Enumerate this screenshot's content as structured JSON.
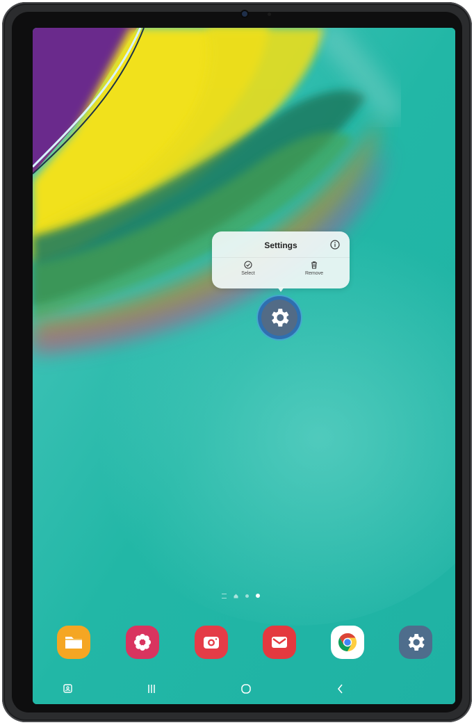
{
  "popup": {
    "title": "Settings",
    "info_icon": "info-icon",
    "actions": [
      {
        "label": "Select",
        "icon": "check-circle-icon"
      },
      {
        "label": "Remove",
        "icon": "trash-icon"
      }
    ]
  },
  "selected_app": {
    "name": "Settings",
    "icon": "gear-icon"
  },
  "page_indicator": {
    "pages": [
      "list",
      "home",
      "page",
      "page"
    ],
    "active_index": 3
  },
  "dock": {
    "apps": [
      {
        "name": "My Files",
        "icon": "folder-icon",
        "color": "#f5a623"
      },
      {
        "name": "Bixby Vision",
        "icon": "flower-icon",
        "color": "#d9345f"
      },
      {
        "name": "Camera",
        "icon": "camera-icon",
        "color": "#e43c47"
      },
      {
        "name": "Email",
        "icon": "mail-icon",
        "color": "#e4393f"
      },
      {
        "name": "Chrome",
        "icon": "chrome-icon",
        "color": "#ffffff"
      },
      {
        "name": "Settings",
        "icon": "gear-icon",
        "color": "#4e6d8c"
      }
    ]
  },
  "navbar": {
    "buttons": [
      "screenshot-icon",
      "recents-icon",
      "home-icon",
      "back-icon"
    ]
  }
}
